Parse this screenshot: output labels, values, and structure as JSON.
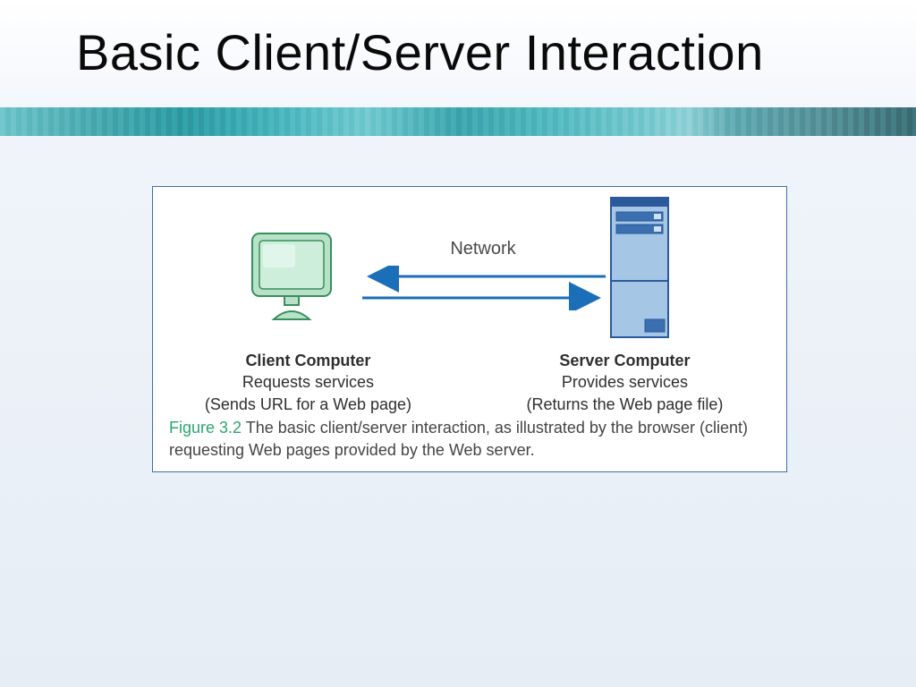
{
  "title": "Basic Client/Server Interaction",
  "diagram": {
    "network_label": "Network",
    "client": {
      "heading": "Client Computer",
      "line1": "Requests services",
      "line2": "(Sends URL for a Web page)"
    },
    "server": {
      "heading": "Server Computer",
      "line1": "Provides services",
      "line2": "(Returns the Web page file)"
    },
    "caption_label": "Figure 3.2",
    "caption_text": "The basic client/server interaction, as illustrated by the browser (client) requesting Web pages provided by the Web server."
  },
  "colors": {
    "arrow": "#1b6fb8",
    "client_fill": "#b7e2c9",
    "client_stroke": "#3a8f5a",
    "server_fill": "#a6c6e6",
    "server_stroke": "#2a5a99",
    "figlabel": "#2aa76f"
  }
}
